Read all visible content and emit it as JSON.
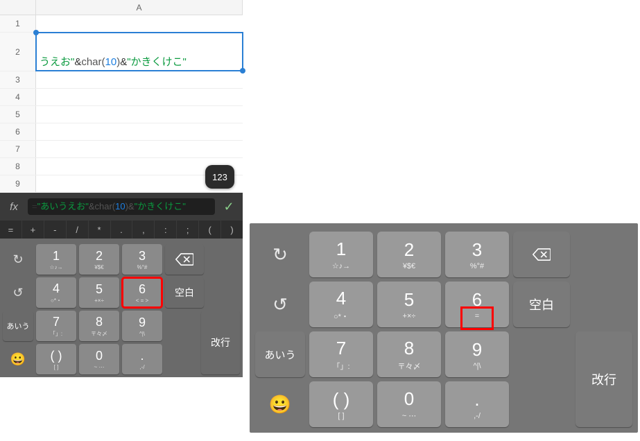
{
  "sheet": {
    "col_header": "A",
    "rows": [
      "1",
      "2",
      "3",
      "4",
      "5",
      "6",
      "7",
      "8",
      "9"
    ],
    "active_row_index": 1,
    "formula_tokens": [
      {
        "t": "うえお\"",
        "c": "str"
      },
      {
        "t": "&",
        "c": "op"
      },
      {
        "t": "char(",
        "c": "fn"
      },
      {
        "t": "10",
        "c": "num"
      },
      {
        "t": ")",
        "c": "fn"
      },
      {
        "t": "&",
        "c": "op"
      },
      {
        "t": "\"かきくけこ\"",
        "c": "str"
      }
    ]
  },
  "badge": "123",
  "fx": {
    "label": "fx",
    "tokens": [
      {
        "t": "=",
        "c": "op"
      },
      {
        "t": "\"あいうえお\"",
        "c": "str"
      },
      {
        "t": "&char(",
        "c": "fn"
      },
      {
        "t": "10",
        "c": "num"
      },
      {
        "t": ")&",
        "c": "fn"
      },
      {
        "t": "\"かきくけこ\"",
        "c": "str"
      }
    ],
    "check": "✓"
  },
  "oprow": [
    "=",
    "+",
    "-",
    "/",
    "*",
    ".",
    ",",
    ":",
    ";",
    "(",
    ")"
  ],
  "kb": {
    "undo": "↻",
    "redo": "↺",
    "aiu": "あいう",
    "emoji": "😀",
    "blank": "空白",
    "enter": "改行",
    "keys": [
      {
        "m": "1",
        "s": "☆♪→"
      },
      {
        "m": "2",
        "s": "¥$€"
      },
      {
        "m": "3",
        "s": "%°#"
      },
      {
        "m": "4",
        "s": "○*・"
      },
      {
        "m": "5",
        "s": "+×÷"
      },
      {
        "m": "6",
        "s": "< = >"
      },
      {
        "m": "7",
        "s": "「」:"
      },
      {
        "m": "8",
        "s": "〒々〆"
      },
      {
        "m": "9",
        "s": "^|\\"
      },
      {
        "m": "( )",
        "s": "[ ]"
      },
      {
        "m": "0",
        "s": "~ ⋯"
      },
      {
        "m": ".",
        "s": ",-/"
      }
    ],
    "highlight_small_index": 5,
    "right_highlight_index": 5,
    "right_highlight_sub": "="
  }
}
